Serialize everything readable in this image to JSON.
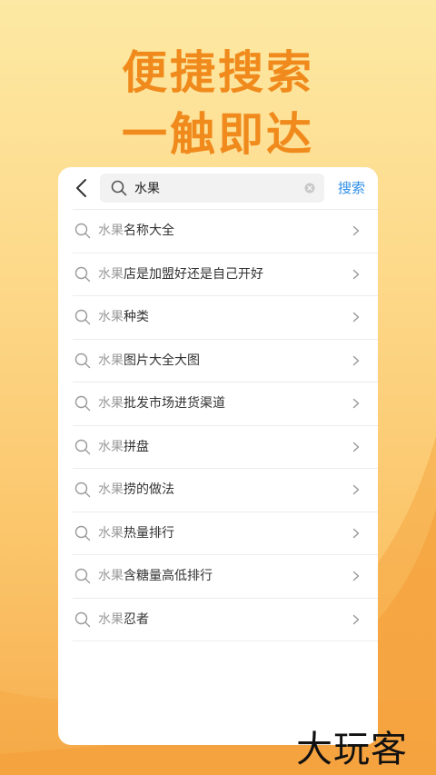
{
  "headline": {
    "line1": "便捷搜索",
    "line2": "一触即达"
  },
  "search": {
    "query": "水果",
    "button_label": "搜索"
  },
  "suggestions": [
    {
      "keyword": "水果",
      "rest": "名称大全"
    },
    {
      "keyword": "水果",
      "rest": "店是加盟好还是自己开好"
    },
    {
      "keyword": "水果",
      "rest": "种类"
    },
    {
      "keyword": "水果",
      "rest": "图片大全大图"
    },
    {
      "keyword": "水果",
      "rest": "批发市场进货渠道"
    },
    {
      "keyword": "水果",
      "rest": "拼盘"
    },
    {
      "keyword": "水果",
      "rest": "捞的做法"
    },
    {
      "keyword": "水果",
      "rest": "热量排行"
    },
    {
      "keyword": "水果",
      "rest": "含糖量高低排行"
    },
    {
      "keyword": "水果",
      "rest": "忍者"
    }
  ],
  "logo": {
    "text": "大玩客"
  },
  "colors": {
    "headline": "#f08a1c",
    "search_button": "#2e8ee8",
    "keyword": "#999999",
    "text": "#333333"
  },
  "icons": {
    "back": "chevron-left-icon",
    "search": "search-icon",
    "clear": "clear-icon",
    "row_arrow": "chevron-right-icon"
  }
}
